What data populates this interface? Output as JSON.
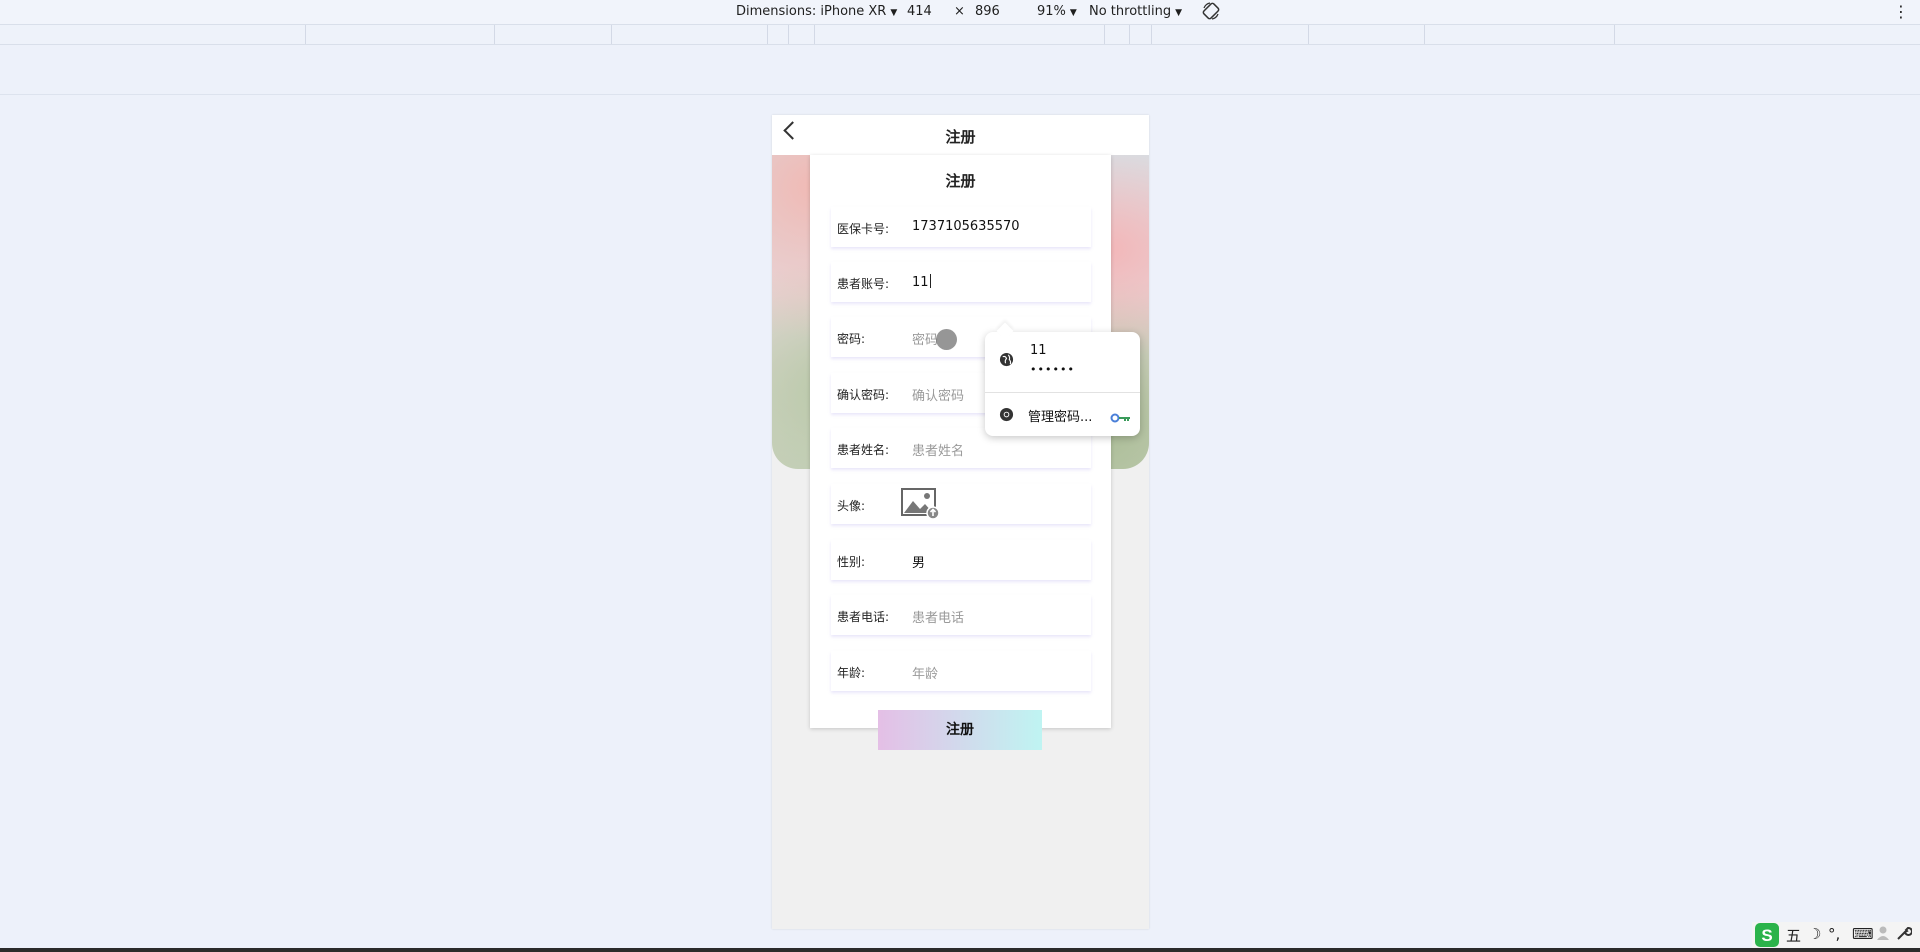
{
  "devtools": {
    "dimensions_label": "Dimensions: iPhone XR",
    "width": "414",
    "times": "×",
    "height": "896",
    "zoom": "91%",
    "throttling": "No throttling",
    "more_icon": "⋮"
  },
  "nav": {
    "title": "注册"
  },
  "form": {
    "title": "注册",
    "fields": [
      {
        "label": "医保卡号:",
        "value": "1737105635570",
        "placeholder": ""
      },
      {
        "label": "患者账号:",
        "value": "11",
        "placeholder": ""
      },
      {
        "label": "密码:",
        "value": "",
        "placeholder": "密码"
      },
      {
        "label": "确认密码:",
        "value": "",
        "placeholder": "确认密码"
      },
      {
        "label": "患者姓名:",
        "value": "",
        "placeholder": "患者姓名"
      },
      {
        "label": "头像:",
        "value": "",
        "placeholder": ""
      },
      {
        "label": "性别:",
        "value": "男",
        "placeholder": ""
      },
      {
        "label": "患者电话:",
        "value": "",
        "placeholder": "患者电话"
      },
      {
        "label": "年龄:",
        "value": "",
        "placeholder": "年龄"
      }
    ],
    "submit_label": "注册"
  },
  "autofill": {
    "username": "11",
    "password_mask": "••••••",
    "manage_label": "管理密码..."
  },
  "tray": {
    "ime_mode": "五",
    "moon": "☽",
    "punct": "°,",
    "keyboard": "⌨"
  },
  "colors": {
    "page_bg": "#edf1fa",
    "submit_gradient_start": "#e4bfe6",
    "submit_gradient_end": "#bff4f2"
  }
}
